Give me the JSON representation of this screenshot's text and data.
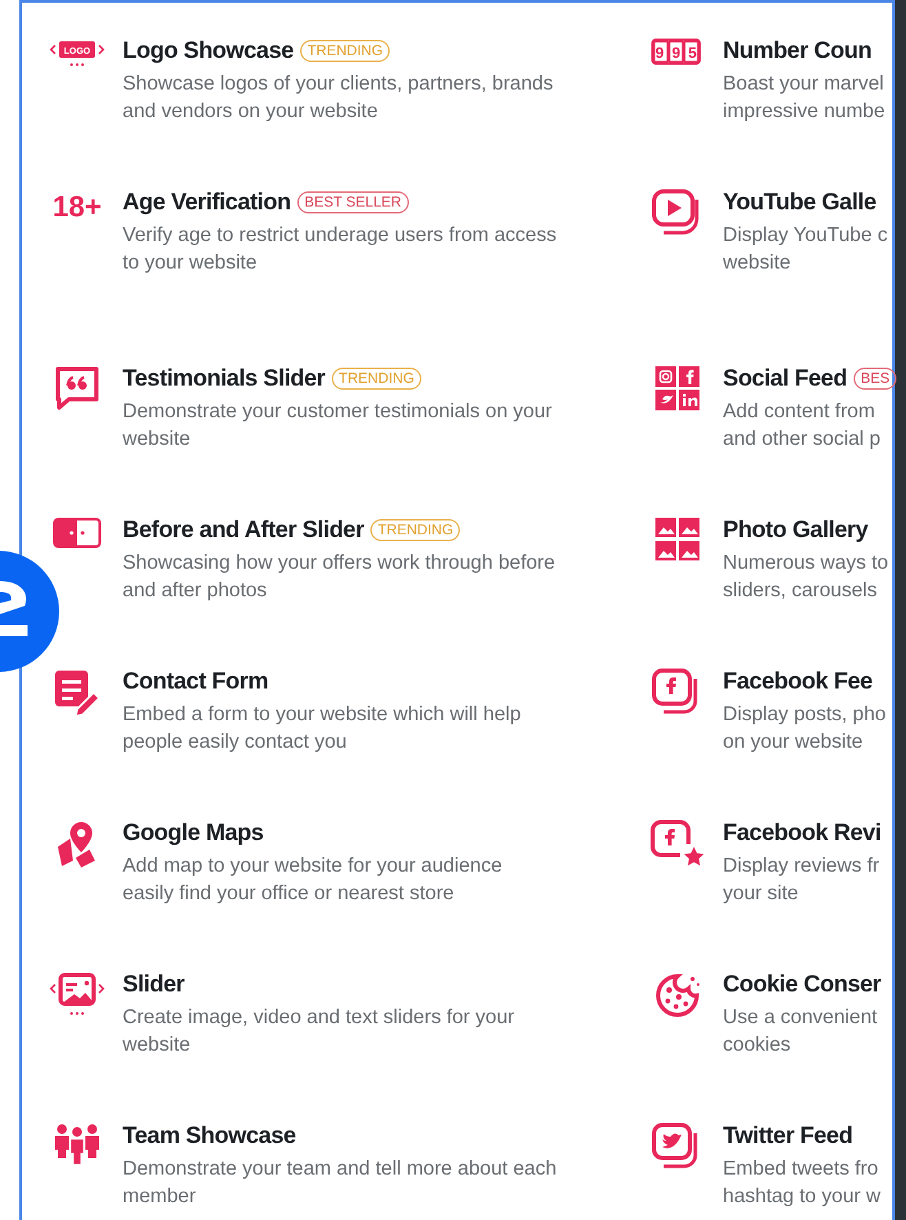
{
  "left_column": [
    {
      "title": "Logo Showcase",
      "icon_text": "LOGO",
      "badge": {
        "text": "TRENDING",
        "kind": "trending"
      },
      "description_lines": [
        "Showcase logos of your clients, partners, brands",
        "and vendors on your website"
      ]
    },
    {
      "title": "Age Verification",
      "icon_text": "18+",
      "badge": {
        "text": "BEST SELLER",
        "kind": "best_seller"
      },
      "description_lines": [
        "Verify age to restrict underage users from access",
        "to your website"
      ]
    },
    {
      "title": "Testimonials Slider",
      "badge": {
        "text": "TRENDING",
        "kind": "trending"
      },
      "description_lines": [
        "Demonstrate your customer testimonials on your",
        "website"
      ]
    },
    {
      "title": "Before and After Slider",
      "badge": {
        "text": "TRENDING",
        "kind": "trending"
      },
      "description_lines": [
        "Showcasing how your offers work through before",
        "and after photos"
      ]
    },
    {
      "title": "Contact Form",
      "description_lines": [
        "Embed a form to your website which will help",
        "people easily contact you"
      ]
    },
    {
      "title": "Google Maps",
      "description_lines": [
        "Add map to your website for your audience",
        "easily find your office or nearest store"
      ]
    },
    {
      "title": "Slider",
      "description_lines": [
        "Create image, video and text sliders for your",
        "website"
      ]
    },
    {
      "title": "Team Showcase",
      "description_lines": [
        "Demonstrate your team and tell more about each",
        "member"
      ]
    }
  ],
  "right_column": [
    {
      "title": "Number Coun",
      "icon_text": "995",
      "description_lines": [
        "Boast your marvel",
        "impressive numbe"
      ]
    },
    {
      "title": "YouTube Galle",
      "description_lines": [
        "Display YouTube c",
        "website"
      ]
    },
    {
      "title": "Social Feed",
      "badge": {
        "text": "BES",
        "kind": "best_seller"
      },
      "description_lines": [
        "Add content from",
        "and other social p"
      ]
    },
    {
      "title": "Photo Gallery",
      "description_lines": [
        "Numerous ways to",
        "sliders, carousels"
      ]
    },
    {
      "title": "Facebook Fee",
      "description_lines": [
        "Display posts, pho",
        "on your website"
      ]
    },
    {
      "title": "Facebook Revi",
      "description_lines": [
        "Display reviews fr",
        "your site"
      ]
    },
    {
      "title": "Cookie Conser",
      "description_lines": [
        "Use a convenient",
        "cookies"
      ]
    },
    {
      "title": "Twitter Feed",
      "description_lines": [
        "Embed tweets fro",
        "hashtag to your w"
      ]
    }
  ]
}
